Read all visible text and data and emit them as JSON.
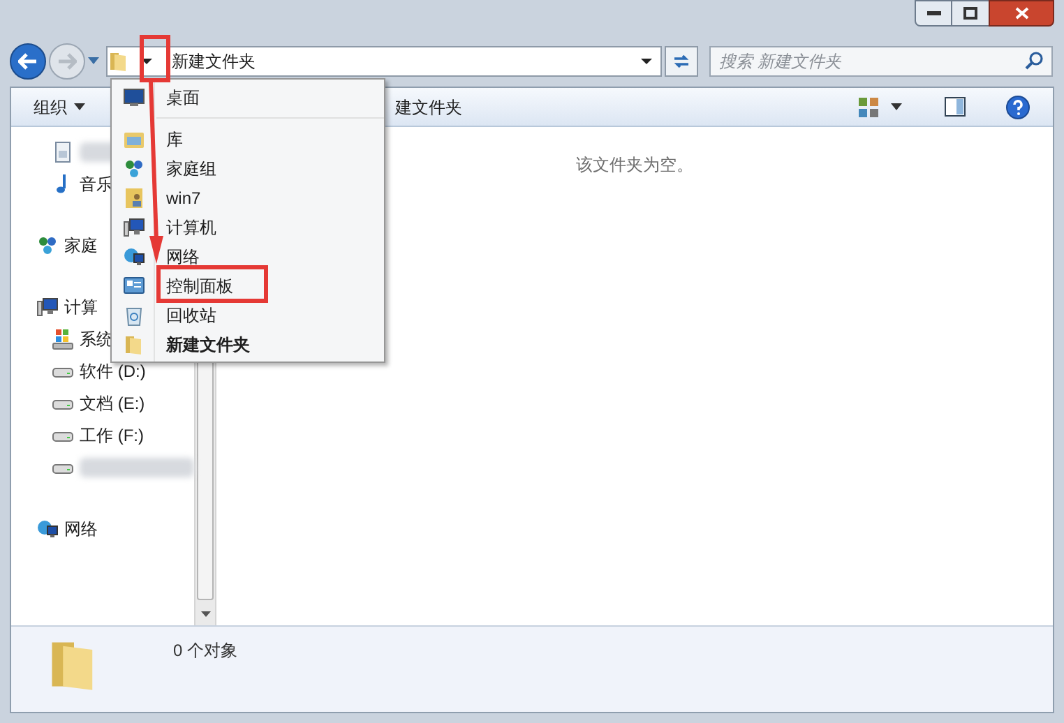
{
  "address_bar": {
    "path": "新建文件夹"
  },
  "search": {
    "placeholder": "搜索 新建文件夹"
  },
  "toolbar": {
    "organize": "组织",
    "partial_button": "建文件夹"
  },
  "sidebar": {
    "sections": [
      {
        "items": [
          {
            "kind": "redacted"
          },
          {
            "kind": "item",
            "label": "音乐"
          }
        ]
      },
      {
        "header": {
          "label": "家庭"
        }
      },
      {
        "header": {
          "label": "计算"
        },
        "items": [
          {
            "kind": "item",
            "label": "系统"
          },
          {
            "kind": "item",
            "label": "软件 (D:)"
          },
          {
            "kind": "item",
            "label": "文档 (E:)"
          },
          {
            "kind": "item",
            "label": "工作 (F:)"
          },
          {
            "kind": "redacted"
          }
        ]
      },
      {
        "header": {
          "label": "网络"
        }
      }
    ]
  },
  "content": {
    "empty_message": "该文件夹为空。"
  },
  "status_bar": {
    "count": "0 个对象"
  },
  "location_menu": {
    "items": [
      {
        "label": "桌面",
        "current": false
      },
      {
        "label": "库",
        "current": false
      },
      {
        "label": "家庭组",
        "current": false
      },
      {
        "label": "win7",
        "current": false
      },
      {
        "label": "计算机",
        "current": false
      },
      {
        "label": "网络",
        "current": false
      },
      {
        "label": "控制面板",
        "current": false
      },
      {
        "label": "回收站",
        "current": false
      },
      {
        "label": "新建文件夹",
        "current": true
      }
    ]
  }
}
